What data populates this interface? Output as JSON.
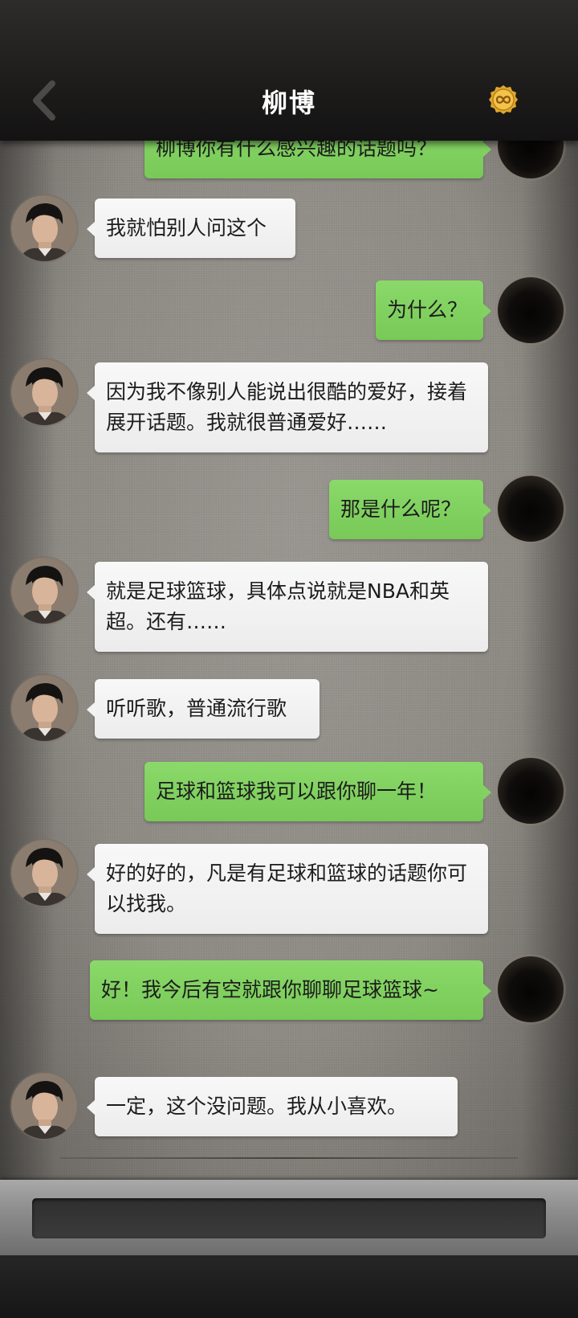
{
  "header": {
    "title": "柳博",
    "back_icon": "chevron-left-icon",
    "coin_icon": "infinity-coin-icon"
  },
  "messages": [
    {
      "side": "out",
      "text": "柳博你有什么感兴趣的话题吗？"
    },
    {
      "side": "in",
      "text": "我就怕别人问这个"
    },
    {
      "side": "out",
      "text": "为什么？"
    },
    {
      "side": "in",
      "text": "因为我不像别人能说出很酷的爱好，接着展开话题。我就很普通爱好……"
    },
    {
      "side": "out",
      "text": "那是什么呢？"
    },
    {
      "side": "in",
      "text": "就是足球篮球，具体点说就是NBA和英超。还有……"
    },
    {
      "side": "in",
      "text": "听听歌，普通流行歌"
    },
    {
      "side": "out",
      "text": "足球和篮球我可以跟你聊一年！"
    },
    {
      "side": "in",
      "text": "好的好的，凡是有足球和篮球的话题你可以找我。"
    },
    {
      "side": "out",
      "text": "好！我今后有空就跟你聊聊足球篮球~"
    },
    {
      "side": "in",
      "text": "一定，这个没问题。我从小喜欢。"
    }
  ],
  "input": {
    "value": "",
    "placeholder": ""
  },
  "colors": {
    "outgoing_bubble": "#80d15f",
    "incoming_bubble": "#f2f2f2",
    "header_bg": "#1f1e1d",
    "chat_bg": "#8e8a84"
  }
}
